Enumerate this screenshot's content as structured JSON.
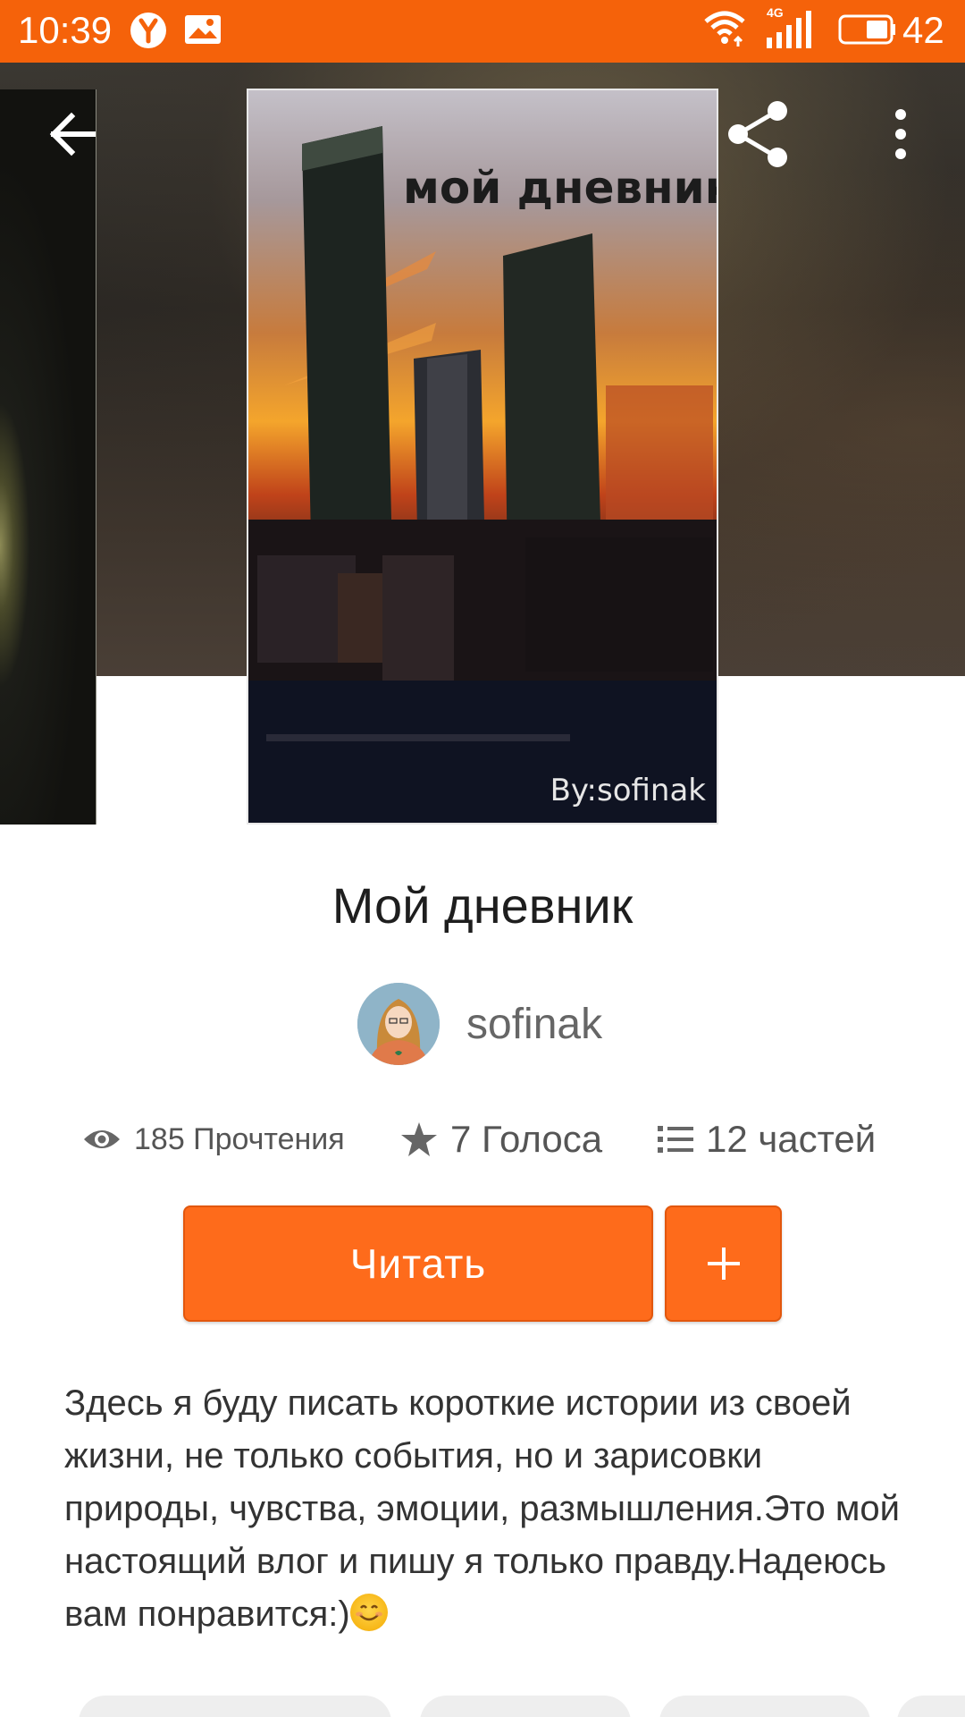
{
  "status_bar": {
    "time": "10:39",
    "network_label": "4G",
    "battery": "42"
  },
  "cover": {
    "title_text": "мой дневник",
    "author_text": "By:sofinak"
  },
  "story": {
    "title": "Мой дневник",
    "author": "sofinak",
    "stats": {
      "reads": "185 Прочтения",
      "votes": "7 Голоса",
      "parts": "12 частей"
    },
    "read_button": "Читать",
    "add_button": "+",
    "description": "Здесь я буду писать короткие истории из своей жизни, не только события, но и зарисовки природы, чувства, эмоции, размышления.Это мой настоящий влог и пишу я только правду.Надеюсь вам понравится:)"
  },
  "icons": {
    "back": "back-arrow-icon",
    "share": "share-icon",
    "more": "more-vertical-icon",
    "reads": "eye-icon",
    "votes": "star-icon",
    "parts": "list-icon",
    "emoji": "smiling-face-emoji"
  },
  "colors": {
    "status_bar": "#f5620a",
    "accent": "#fe6b1b"
  }
}
